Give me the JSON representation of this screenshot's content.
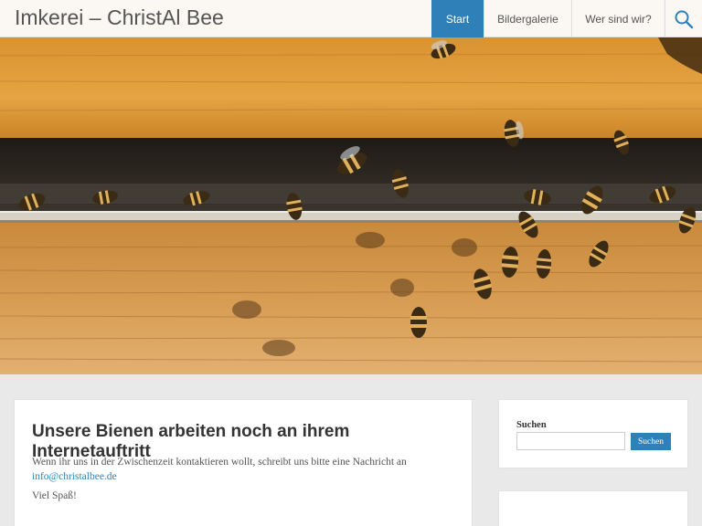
{
  "header": {
    "site_title": "Imkerei – ChristAl Bee",
    "nav": [
      {
        "label": "Start"
      },
      {
        "label": "Bildergalerie"
      },
      {
        "label": "Wer sind wir?"
      }
    ]
  },
  "icons": {
    "search": "search-icon"
  },
  "content": {
    "title": "Unsere Bienen arbeiten noch an ihrem Internetauftritt",
    "text_before_link": "Wenn ihr uns in der Zwischenzeit kontaktieren wollt, schreibt uns bitte eine Nachricht an",
    "email_link": "info@christalbee.de",
    "sign_off": "Viel Spaß!"
  },
  "sidebar": {
    "search_title": "Suchen",
    "search_input_value": "",
    "search_button": "Suchen"
  },
  "colors": {
    "accent": "#2f80b8",
    "header_bg": "#fbf8f4",
    "page_bg": "#e9e9e9"
  }
}
